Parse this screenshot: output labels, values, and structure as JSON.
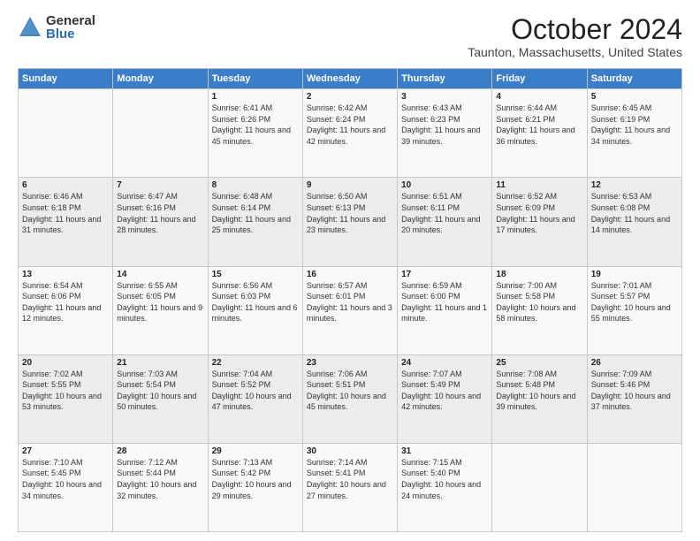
{
  "logo": {
    "general": "General",
    "blue": "Blue"
  },
  "header": {
    "month": "October 2024",
    "location": "Taunton, Massachusetts, United States"
  },
  "weekdays": [
    "Sunday",
    "Monday",
    "Tuesday",
    "Wednesday",
    "Thursday",
    "Friday",
    "Saturday"
  ],
  "weeks": [
    [
      {
        "day": "",
        "sunrise": "",
        "sunset": "",
        "daylight": ""
      },
      {
        "day": "",
        "sunrise": "",
        "sunset": "",
        "daylight": ""
      },
      {
        "day": "1",
        "sunrise": "Sunrise: 6:41 AM",
        "sunset": "Sunset: 6:26 PM",
        "daylight": "Daylight: 11 hours and 45 minutes."
      },
      {
        "day": "2",
        "sunrise": "Sunrise: 6:42 AM",
        "sunset": "Sunset: 6:24 PM",
        "daylight": "Daylight: 11 hours and 42 minutes."
      },
      {
        "day": "3",
        "sunrise": "Sunrise: 6:43 AM",
        "sunset": "Sunset: 6:23 PM",
        "daylight": "Daylight: 11 hours and 39 minutes."
      },
      {
        "day": "4",
        "sunrise": "Sunrise: 6:44 AM",
        "sunset": "Sunset: 6:21 PM",
        "daylight": "Daylight: 11 hours and 36 minutes."
      },
      {
        "day": "5",
        "sunrise": "Sunrise: 6:45 AM",
        "sunset": "Sunset: 6:19 PM",
        "daylight": "Daylight: 11 hours and 34 minutes."
      }
    ],
    [
      {
        "day": "6",
        "sunrise": "Sunrise: 6:46 AM",
        "sunset": "Sunset: 6:18 PM",
        "daylight": "Daylight: 11 hours and 31 minutes."
      },
      {
        "day": "7",
        "sunrise": "Sunrise: 6:47 AM",
        "sunset": "Sunset: 6:16 PM",
        "daylight": "Daylight: 11 hours and 28 minutes."
      },
      {
        "day": "8",
        "sunrise": "Sunrise: 6:48 AM",
        "sunset": "Sunset: 6:14 PM",
        "daylight": "Daylight: 11 hours and 25 minutes."
      },
      {
        "day": "9",
        "sunrise": "Sunrise: 6:50 AM",
        "sunset": "Sunset: 6:13 PM",
        "daylight": "Daylight: 11 hours and 23 minutes."
      },
      {
        "day": "10",
        "sunrise": "Sunrise: 6:51 AM",
        "sunset": "Sunset: 6:11 PM",
        "daylight": "Daylight: 11 hours and 20 minutes."
      },
      {
        "day": "11",
        "sunrise": "Sunrise: 6:52 AM",
        "sunset": "Sunset: 6:09 PM",
        "daylight": "Daylight: 11 hours and 17 minutes."
      },
      {
        "day": "12",
        "sunrise": "Sunrise: 6:53 AM",
        "sunset": "Sunset: 6:08 PM",
        "daylight": "Daylight: 11 hours and 14 minutes."
      }
    ],
    [
      {
        "day": "13",
        "sunrise": "Sunrise: 6:54 AM",
        "sunset": "Sunset: 6:06 PM",
        "daylight": "Daylight: 11 hours and 12 minutes."
      },
      {
        "day": "14",
        "sunrise": "Sunrise: 6:55 AM",
        "sunset": "Sunset: 6:05 PM",
        "daylight": "Daylight: 11 hours and 9 minutes."
      },
      {
        "day": "15",
        "sunrise": "Sunrise: 6:56 AM",
        "sunset": "Sunset: 6:03 PM",
        "daylight": "Daylight: 11 hours and 6 minutes."
      },
      {
        "day": "16",
        "sunrise": "Sunrise: 6:57 AM",
        "sunset": "Sunset: 6:01 PM",
        "daylight": "Daylight: 11 hours and 3 minutes."
      },
      {
        "day": "17",
        "sunrise": "Sunrise: 6:59 AM",
        "sunset": "Sunset: 6:00 PM",
        "daylight": "Daylight: 11 hours and 1 minute."
      },
      {
        "day": "18",
        "sunrise": "Sunrise: 7:00 AM",
        "sunset": "Sunset: 5:58 PM",
        "daylight": "Daylight: 10 hours and 58 minutes."
      },
      {
        "day": "19",
        "sunrise": "Sunrise: 7:01 AM",
        "sunset": "Sunset: 5:57 PM",
        "daylight": "Daylight: 10 hours and 55 minutes."
      }
    ],
    [
      {
        "day": "20",
        "sunrise": "Sunrise: 7:02 AM",
        "sunset": "Sunset: 5:55 PM",
        "daylight": "Daylight: 10 hours and 53 minutes."
      },
      {
        "day": "21",
        "sunrise": "Sunrise: 7:03 AM",
        "sunset": "Sunset: 5:54 PM",
        "daylight": "Daylight: 10 hours and 50 minutes."
      },
      {
        "day": "22",
        "sunrise": "Sunrise: 7:04 AM",
        "sunset": "Sunset: 5:52 PM",
        "daylight": "Daylight: 10 hours and 47 minutes."
      },
      {
        "day": "23",
        "sunrise": "Sunrise: 7:06 AM",
        "sunset": "Sunset: 5:51 PM",
        "daylight": "Daylight: 10 hours and 45 minutes."
      },
      {
        "day": "24",
        "sunrise": "Sunrise: 7:07 AM",
        "sunset": "Sunset: 5:49 PM",
        "daylight": "Daylight: 10 hours and 42 minutes."
      },
      {
        "day": "25",
        "sunrise": "Sunrise: 7:08 AM",
        "sunset": "Sunset: 5:48 PM",
        "daylight": "Daylight: 10 hours and 39 minutes."
      },
      {
        "day": "26",
        "sunrise": "Sunrise: 7:09 AM",
        "sunset": "Sunset: 5:46 PM",
        "daylight": "Daylight: 10 hours and 37 minutes."
      }
    ],
    [
      {
        "day": "27",
        "sunrise": "Sunrise: 7:10 AM",
        "sunset": "Sunset: 5:45 PM",
        "daylight": "Daylight: 10 hours and 34 minutes."
      },
      {
        "day": "28",
        "sunrise": "Sunrise: 7:12 AM",
        "sunset": "Sunset: 5:44 PM",
        "daylight": "Daylight: 10 hours and 32 minutes."
      },
      {
        "day": "29",
        "sunrise": "Sunrise: 7:13 AM",
        "sunset": "Sunset: 5:42 PM",
        "daylight": "Daylight: 10 hours and 29 minutes."
      },
      {
        "day": "30",
        "sunrise": "Sunrise: 7:14 AM",
        "sunset": "Sunset: 5:41 PM",
        "daylight": "Daylight: 10 hours and 27 minutes."
      },
      {
        "day": "31",
        "sunrise": "Sunrise: 7:15 AM",
        "sunset": "Sunset: 5:40 PM",
        "daylight": "Daylight: 10 hours and 24 minutes."
      },
      {
        "day": "",
        "sunrise": "",
        "sunset": "",
        "daylight": ""
      },
      {
        "day": "",
        "sunrise": "",
        "sunset": "",
        "daylight": ""
      }
    ]
  ]
}
